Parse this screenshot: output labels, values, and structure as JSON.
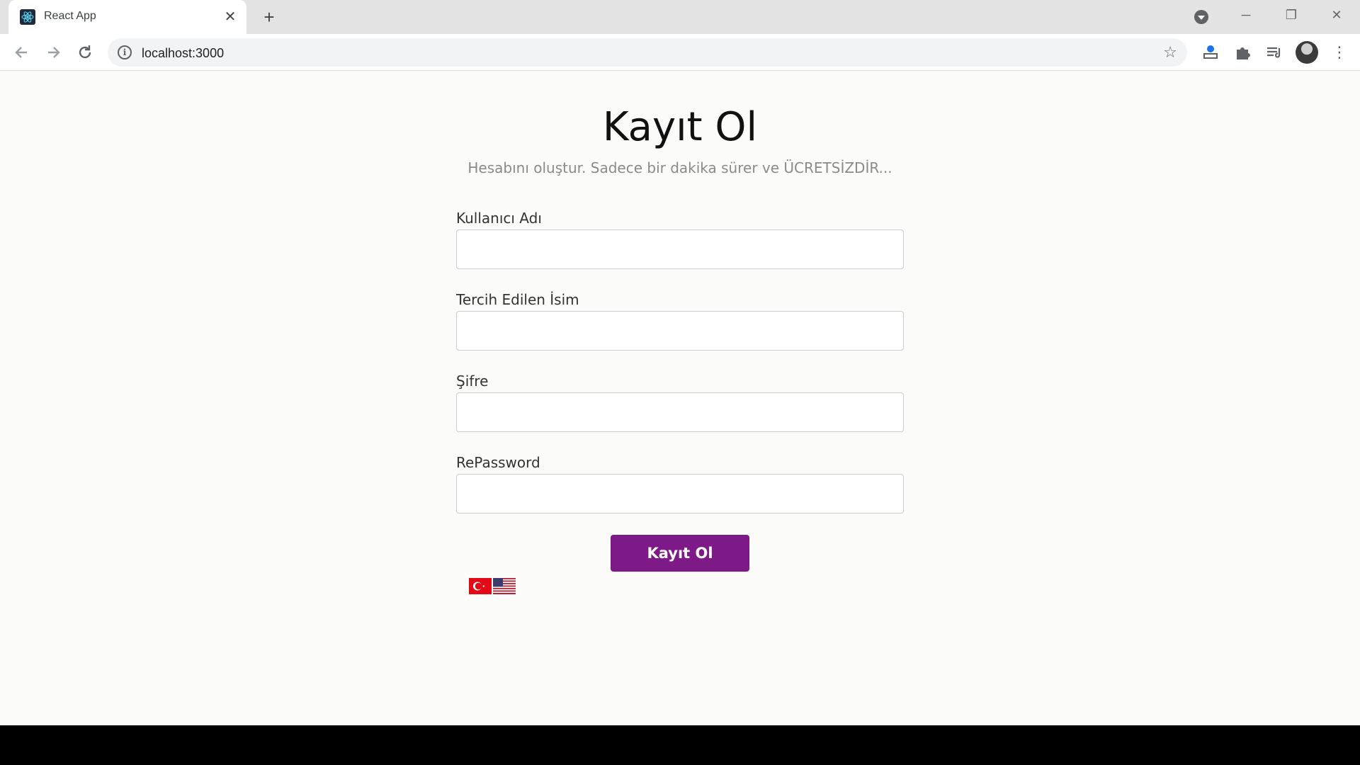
{
  "browser": {
    "tab_title": "React App",
    "tab_close": "✕",
    "new_tab": "+",
    "url": "localhost:3000",
    "window_controls": {
      "minimize": "─",
      "restore": "❐",
      "close": "✕"
    },
    "icons": {
      "back": "back-arrow-icon",
      "forward": "forward-arrow-icon",
      "reload": "reload-icon",
      "info": "info-icon",
      "star": "star-icon",
      "extension1": "extension-icon",
      "puzzle": "puzzle-icon",
      "media": "media-queue-icon",
      "menu": "kebab-menu-icon"
    }
  },
  "page": {
    "title": "Kayıt Ol",
    "subtitle": "Hesabını oluştur. Sadece bir dakika sürer ve ÜCRETSİZDİR...",
    "fields": [
      {
        "label": "Kullanıcı Adı",
        "value": "",
        "type": "text"
      },
      {
        "label": "Tercih Edilen İsim",
        "value": "",
        "type": "text"
      },
      {
        "label": "Şifre",
        "value": "",
        "type": "password"
      },
      {
        "label": "RePassword",
        "value": "",
        "type": "password"
      }
    ],
    "submit_label": "Kayıt Ol",
    "languages": [
      "tr-flag-icon",
      "us-flag-icon"
    ]
  },
  "colors": {
    "accent": "#7d1a87",
    "page_bg": "#fbfbfa",
    "subtitle": "#8a8a8a"
  }
}
